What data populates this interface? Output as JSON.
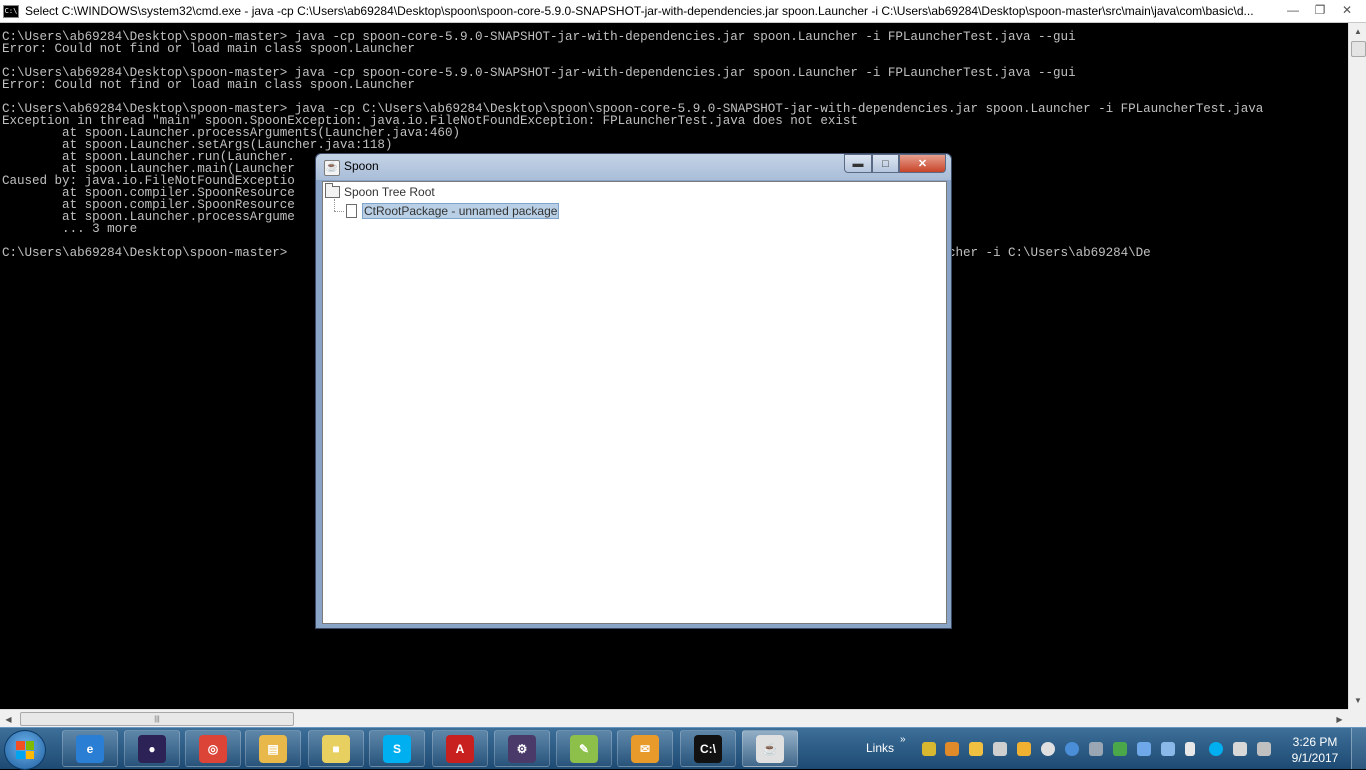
{
  "cmd": {
    "title": "Select C:\\WINDOWS\\system32\\cmd.exe - java  -cp C:\\Users\\ab69284\\Desktop\\spoon\\spoon-core-5.9.0-SNAPSHOT-jar-with-dependencies.jar spoon.Launcher -i C:\\Users\\ab69284\\Desktop\\spoon-master\\src\\main\\java\\com\\basic\\d...",
    "lines": [
      "C:\\Users\\ab69284\\Desktop\\spoon-master> java -cp spoon-core-5.9.0-SNAPSHOT-jar-with-dependencies.jar spoon.Launcher -i FPLauncherTest.java --gui",
      "Error: Could not find or load main class spoon.Launcher",
      "",
      "C:\\Users\\ab69284\\Desktop\\spoon-master> java -cp spoon-core-5.9.0-SNAPSHOT-jar-with-dependencies.jar spoon.Launcher -i FPLauncherTest.java --gui",
      "Error: Could not find or load main class spoon.Launcher",
      "",
      "C:\\Users\\ab69284\\Desktop\\spoon-master> java -cp C:\\Users\\ab69284\\Desktop\\spoon\\spoon-core-5.9.0-SNAPSHOT-jar-with-dependencies.jar spoon.Launcher -i FPLauncherTest.java",
      "Exception in thread \"main\" spoon.SpoonException: java.io.FileNotFoundException: FPLauncherTest.java does not exist",
      "        at spoon.Launcher.processArguments(Launcher.java:460)",
      "        at spoon.Launcher.setArgs(Launcher.java:118)",
      "        at spoon.Launcher.run(Launcher.",
      "        at spoon.Launcher.main(Launcher",
      "Caused by: java.io.FileNotFoundExceptio",
      "        at spoon.compiler.SpoonResource",
      "        at spoon.compiler.SpoonResource",
      "        at spoon.Launcher.processArgume",
      "        ... 3 more",
      "",
      "C:\\Users\\ab69284\\Desktop\\spoon-master>                                                                  dencies.jar spoon.Launcher -i C:\\Users\\ab69284\\De"
    ]
  },
  "spoon_window": {
    "title": "Spoon",
    "tree": {
      "root_label": "Spoon Tree Root",
      "child_label": "CtRootPackage - unnamed package"
    }
  },
  "taskbar": {
    "links_label": "Links",
    "clock_time": "3:26 PM",
    "clock_date": "9/1/2017",
    "apps": [
      {
        "name": "internet-explorer",
        "color": "#2a7fd4",
        "glyph": "e"
      },
      {
        "name": "eclipse",
        "color": "#2c2255",
        "glyph": "●"
      },
      {
        "name": "chrome",
        "color": "#db4437",
        "glyph": "◎"
      },
      {
        "name": "file-explorer",
        "color": "#e8b84a",
        "glyph": "▤"
      },
      {
        "name": "sticky-notes",
        "color": "#e8d060",
        "glyph": "■"
      },
      {
        "name": "skype",
        "color": "#00aff0",
        "glyph": "S"
      },
      {
        "name": "adobe-reader",
        "color": "#c8201e",
        "glyph": "A"
      },
      {
        "name": "java-ee-ide",
        "color": "#4a3a6a",
        "glyph": "⚙"
      },
      {
        "name": "notepad-plus-plus",
        "color": "#8cc04a",
        "glyph": "✎"
      },
      {
        "name": "outlook",
        "color": "#e89a2a",
        "glyph": "✉"
      },
      {
        "name": "command-prompt",
        "color": "#111111",
        "glyph": "C:\\"
      },
      {
        "name": "java",
        "color": "#e0e0e0",
        "glyph": "☕"
      }
    ]
  }
}
